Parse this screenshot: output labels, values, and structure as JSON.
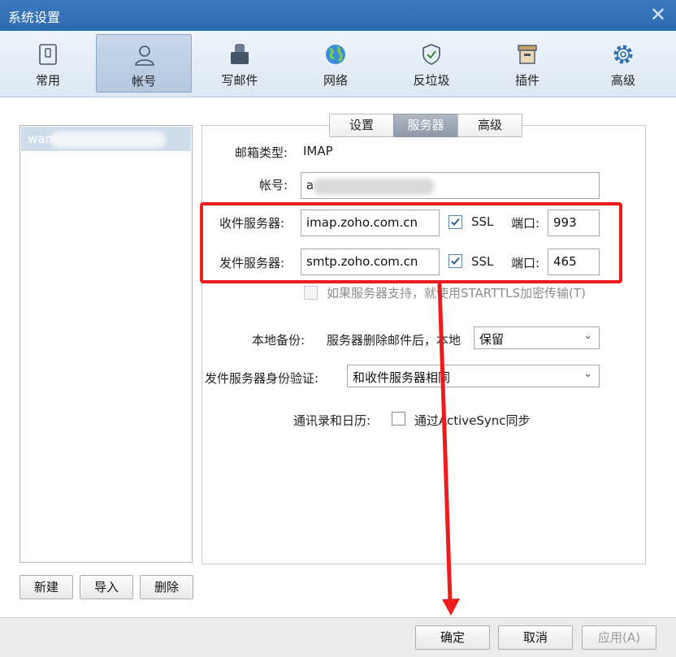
{
  "window": {
    "title": "系统设置",
    "close_glyph": "✕"
  },
  "toolbar": {
    "items": [
      {
        "label": "常用",
        "icon": "general-icon"
      },
      {
        "label": "帐号",
        "icon": "account-icon",
        "active": true
      },
      {
        "label": "写邮件",
        "icon": "compose-icon"
      },
      {
        "label": "网络",
        "icon": "network-icon"
      },
      {
        "label": "反垃圾",
        "icon": "antispam-icon"
      },
      {
        "label": "插件",
        "icon": "plugin-icon"
      },
      {
        "label": "高级",
        "icon": "gear-icon"
      }
    ]
  },
  "accounts": {
    "selected_label": "wan"
  },
  "list_buttons": {
    "new": "新建",
    "import": "导入",
    "delete": "删除"
  },
  "tabs": [
    {
      "label": "设置"
    },
    {
      "label": "服务器",
      "active": true
    },
    {
      "label": "高级"
    }
  ],
  "form": {
    "mailbox_type_label": "邮箱类型:",
    "mailbox_type_value": "IMAP",
    "account_label": "帐号:",
    "account_value": "a",
    "incoming_label": "收件服务器:",
    "incoming_value": "imap.zoho.com.cn",
    "incoming_ssl_label": "SSL",
    "incoming_ssl_checked": true,
    "incoming_port_label": "端口:",
    "incoming_port_value": "993",
    "outgoing_label": "发件服务器:",
    "outgoing_value": "smtp.zoho.com.cn",
    "outgoing_ssl_label": "SSL",
    "outgoing_ssl_checked": true,
    "outgoing_port_label": "端口:",
    "outgoing_port_value": "465",
    "starttls_label": "如果服务器支持，就使用STARTTLS加密传输(T)",
    "starttls_checked": false,
    "backup_label": "本地备份:",
    "backup_desc": "服务器删除邮件后，本地",
    "backup_value": "保留",
    "smtp_auth_label": "发件服务器身份验证:",
    "smtp_auth_value": "和收件服务器相同",
    "contacts_label": "通讯录和日历:",
    "activesync_label": "通过ActiveSync同步",
    "activesync_checked": false
  },
  "footer": {
    "ok": "确定",
    "cancel": "取消",
    "apply": "应用(A)"
  },
  "colors": {
    "title_bar": "#2e6cb0",
    "highlight_box": "#ee1c1c",
    "arrow": "#ee1c1c",
    "active_tab": "#9aa5b3"
  }
}
